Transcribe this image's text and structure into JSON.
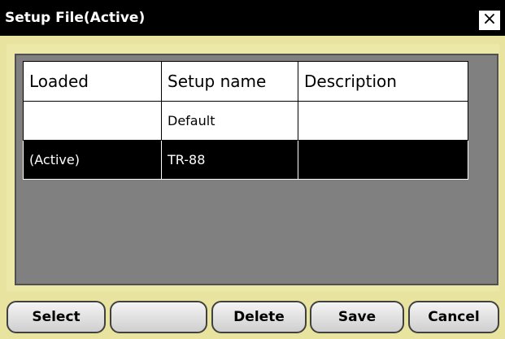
{
  "window": {
    "title": "Setup File(Active)",
    "close_label": "×"
  },
  "table": {
    "headers": [
      "Loaded",
      "Setup name",
      "Description"
    ],
    "rows": [
      {
        "loaded": "",
        "setup_name": "Default",
        "description": ""
      },
      {
        "loaded": "(Active)",
        "setup_name": "TR-88",
        "description": "",
        "selected": true
      }
    ]
  },
  "buttons": {
    "select": "Select",
    "blank": "",
    "delete": "Delete",
    "save": "Save",
    "cancel": "Cancel"
  },
  "colors": {
    "panel_bg": "#e8e4a0",
    "titlebar_bg": "#000000",
    "grid_bg": "#808080",
    "selected_row_bg": "#000000"
  }
}
